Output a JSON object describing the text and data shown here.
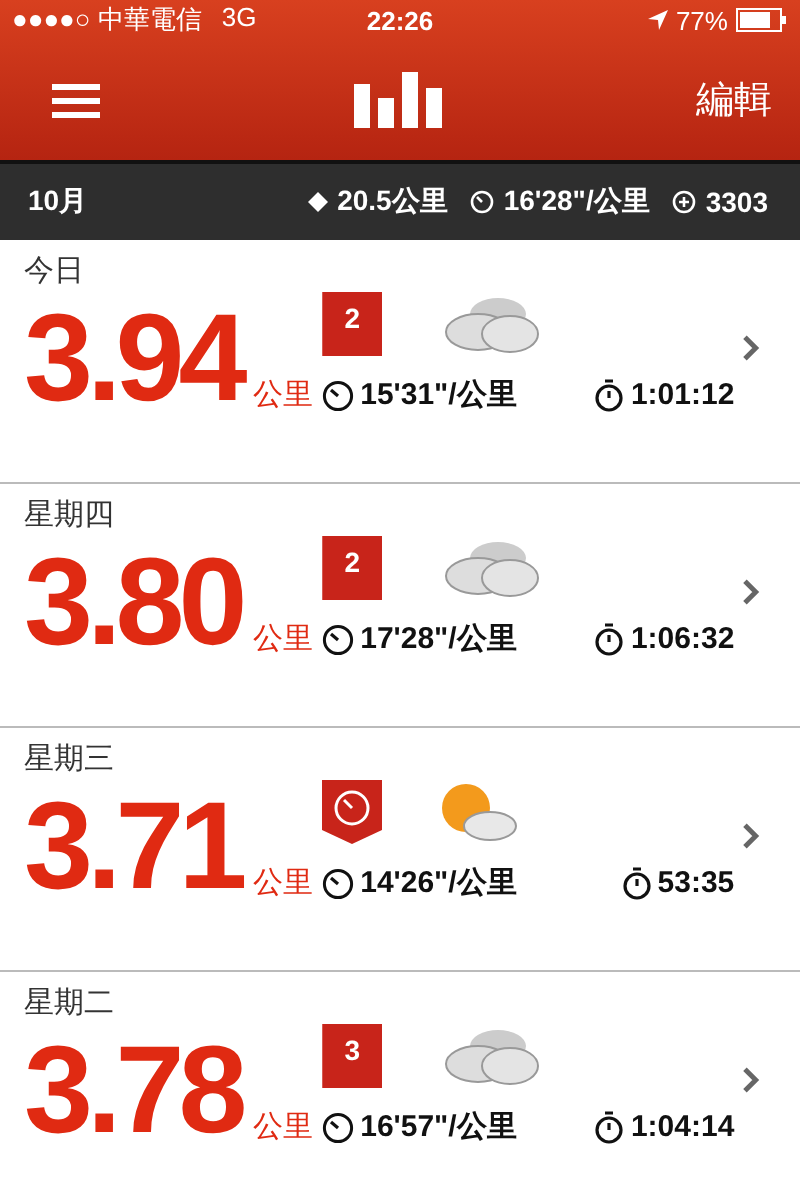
{
  "status_bar": {
    "carrier": "●●●●○ 中華電信",
    "network": "3G",
    "time": "22:26",
    "battery": "77%"
  },
  "nav": {
    "edit": "編輯"
  },
  "summary": {
    "month": "10月",
    "distance": "20.5公里",
    "pace": "16'28\"/公里",
    "fuel": "3303"
  },
  "runs": [
    {
      "day": "今日",
      "distance": "3.94",
      "unit": "公里",
      "badge": {
        "kind": "number",
        "text": "2"
      },
      "weather": {
        "kind": "cloudy"
      },
      "pace": "15'31\"/公里",
      "duration": "1:01:12"
    },
    {
      "day": "星期四",
      "distance": "3.80",
      "unit": "公里",
      "badge": {
        "kind": "number",
        "text": "2"
      },
      "weather": {
        "kind": "cloudy"
      },
      "pace": "17'28\"/公里",
      "duration": "1:06:32"
    },
    {
      "day": "星期三",
      "distance": "3.71",
      "unit": "公里",
      "badge": {
        "kind": "speed"
      },
      "weather": {
        "kind": "partly_sunny"
      },
      "pace": "14'26\"/公里",
      "duration": "53:35"
    },
    {
      "day": "星期二",
      "distance": "3.78",
      "unit": "公里",
      "badge": {
        "kind": "number",
        "text": "3"
      },
      "weather": {
        "kind": "cloudy"
      },
      "pace": "16'57\"/公里",
      "duration": "1:04:14"
    }
  ]
}
